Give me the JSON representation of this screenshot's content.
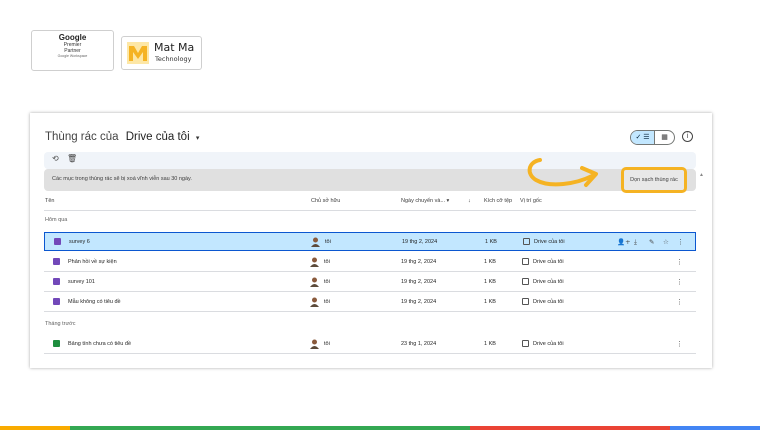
{
  "logos": {
    "google": {
      "brand": "Google",
      "line1": "Premier",
      "line2": "Partner",
      "line3": "Google Workspace"
    },
    "matma": {
      "name": "Mat Ma",
      "tagline": "Technology"
    }
  },
  "header": {
    "title_prefix": "Thùng rác của",
    "title_drive": "Drive của tôi",
    "caret": "▾",
    "view_list": "✓ ☰",
    "view_grid": "▦",
    "info": "i"
  },
  "toolbar": {
    "restore_icon": "⟲",
    "delete_icon": "🗑"
  },
  "banner": {
    "message": "Các mục trong thùng rác sẽ bị xoá vĩnh viễn sau 30 ngày.",
    "empty_button": "Dọn sạch thùng rác"
  },
  "columns": {
    "name": "Tên",
    "owner": "Chủ sở hữu",
    "date": "Ngày chuyển và... ▾",
    "sort": "↓",
    "size": "Kích cỡ tệp",
    "location": "Vị trí gốc"
  },
  "sections": [
    {
      "label": "Hôm qua",
      "rows": [
        {
          "name": "survey 6",
          "type": "form",
          "owner": "tôi",
          "date": "19 thg 2, 2024",
          "size": "1 KB",
          "location": "Drive của tôi",
          "selected": true
        },
        {
          "name": "Phản hồi về sự kiện",
          "type": "form",
          "owner": "tôi",
          "date": "19 thg 2, 2024",
          "size": "1 KB",
          "location": "Drive của tôi",
          "selected": false
        },
        {
          "name": "survey 101",
          "type": "form",
          "owner": "tôi",
          "date": "19 thg 2, 2024",
          "size": "1 KB",
          "location": "Drive của tôi",
          "selected": false
        },
        {
          "name": "Mẫu không có tiêu đề",
          "type": "form",
          "owner": "tôi",
          "date": "19 thg 2, 2024",
          "size": "1 KB",
          "location": "Drive của tôi",
          "selected": false
        }
      ]
    },
    {
      "label": "Tháng trước",
      "rows": [
        {
          "name": "Bảng tính chưa có tiêu đề",
          "type": "sheet",
          "owner": "tôi",
          "date": "23 thg 1, 2024",
          "size": "1 KB",
          "location": "Drive của tôi",
          "selected": false
        }
      ]
    }
  ],
  "row_actions": {
    "share": "👤+",
    "download": "⤓",
    "rename": "✎",
    "star": "☆",
    "more": "⋮"
  },
  "colors": {
    "selected_bg": "#c2e7ff",
    "highlight": "#f5b323",
    "form": "#7248b9",
    "sheet": "#1e8e3e"
  }
}
